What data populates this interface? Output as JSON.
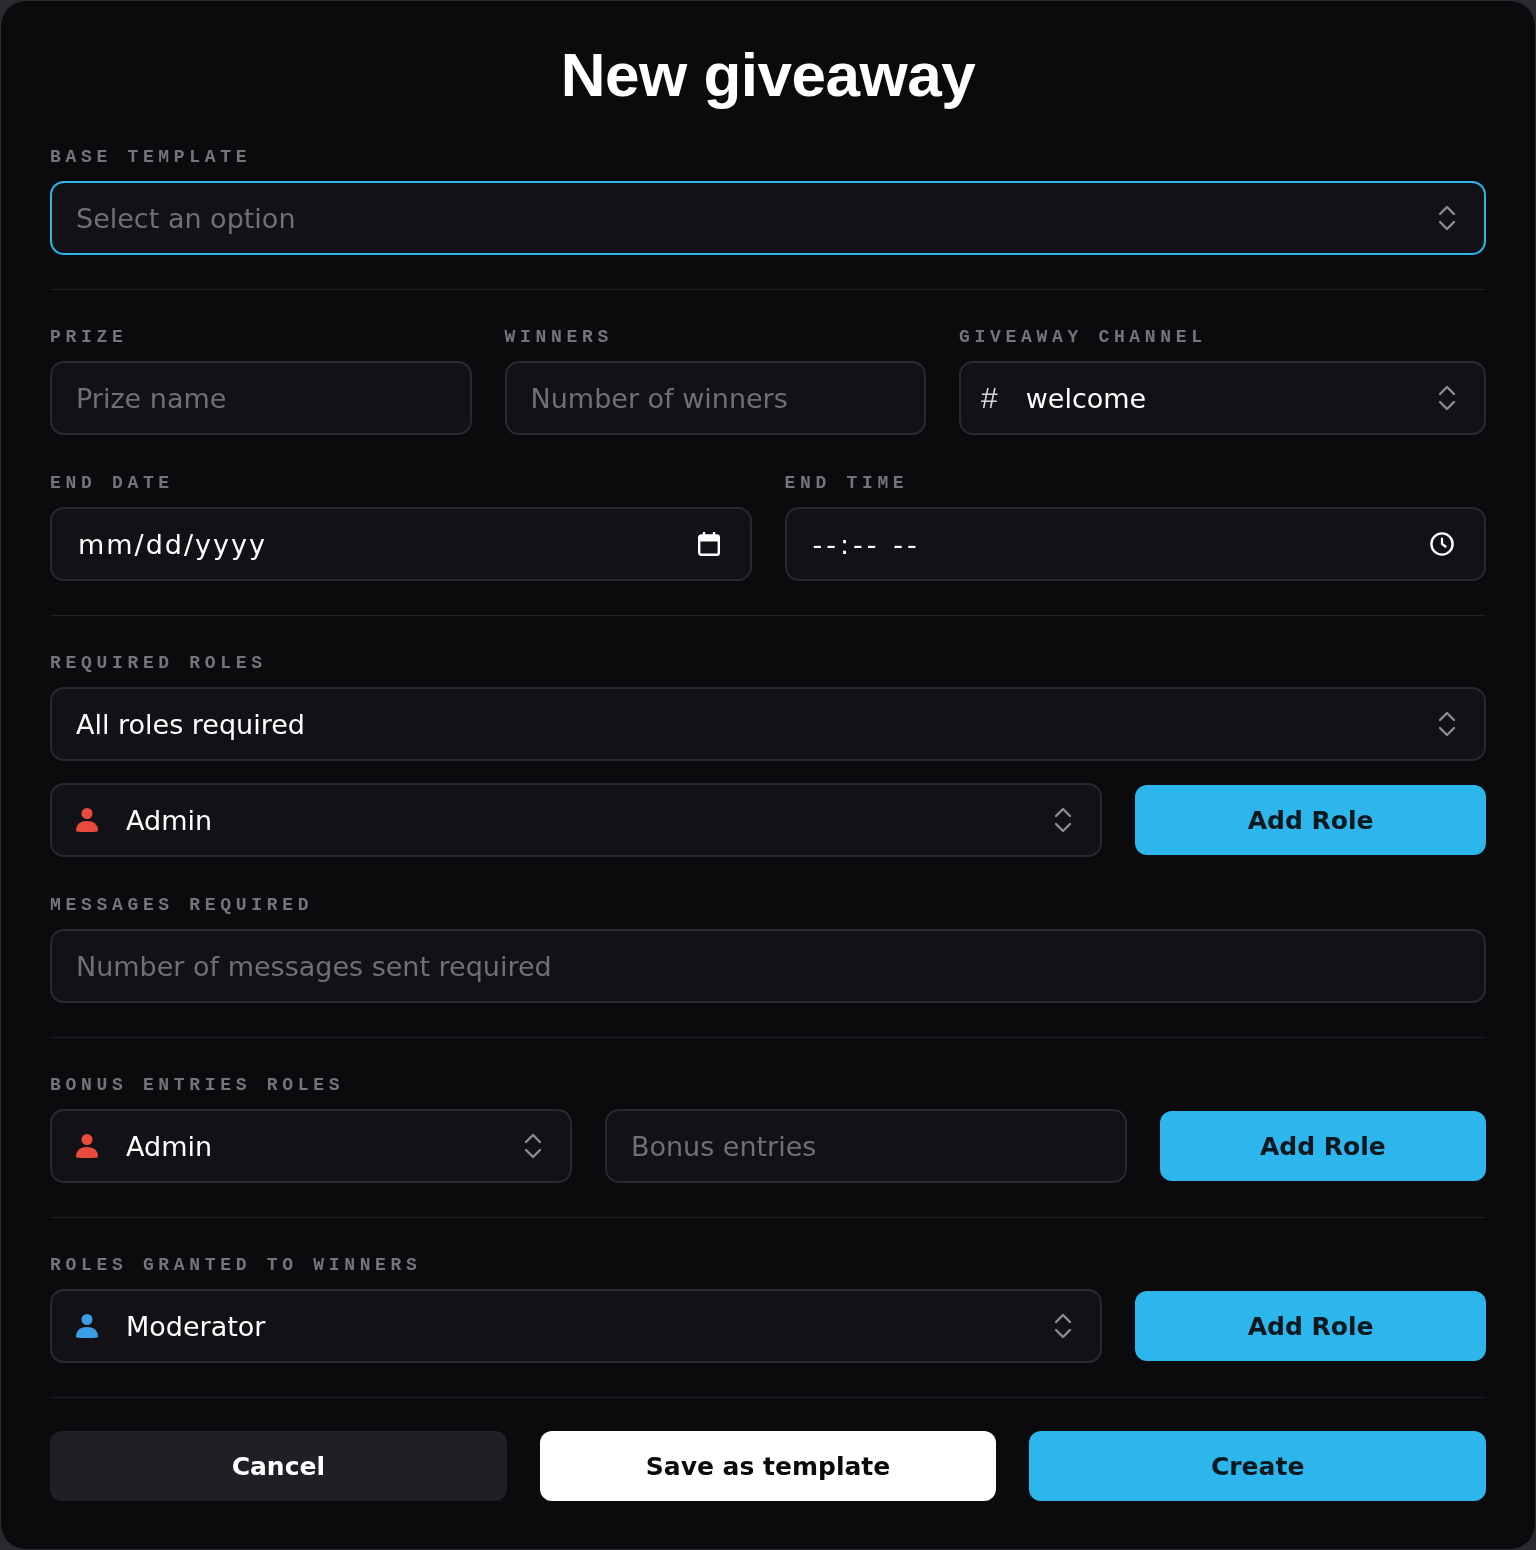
{
  "title": "New giveaway",
  "sections": [
    {
      "rows": [
        {
          "label": "BASE TEMPLATE",
          "items": [
            {
              "kind": "select",
              "placeholder": "Select an option",
              "focused": true
            }
          ]
        }
      ]
    },
    {
      "rows": [
        {
          "items": [
            {
              "kind": "text",
              "label": "PRIZE",
              "placeholder": "Prize name",
              "focused": false
            },
            {
              "kind": "text",
              "label": "WINNERS",
              "placeholder": "Number of winners",
              "focused": false
            },
            {
              "kind": "channel",
              "label": "GIVEAWAY CHANNEL",
              "prefix": "#",
              "value": "welcome",
              "focused": false
            }
          ]
        },
        {
          "items": [
            {
              "kind": "date",
              "label": "END DATE",
              "placeholder": "mm/dd/yyyy",
              "focused": false
            },
            {
              "kind": "time",
              "label": "END TIME",
              "placeholder": "--:-- --",
              "focused": false
            }
          ]
        }
      ]
    },
    {
      "rows": [
        {
          "label": "REQUIRED ROLES",
          "items": [
            {
              "kind": "select",
              "value": "All roles required",
              "focused": false
            }
          ]
        },
        {
          "items": [
            {
              "kind": "role",
              "value": "Admin",
              "color": "#e84b3c",
              "focused": false
            },
            {
              "kind": "button",
              "text": "Add Role"
            }
          ]
        },
        {
          "label": "MESSAGES REQUIRED",
          "items": [
            {
              "kind": "text",
              "placeholder": "Number of messages sent required",
              "focused": false
            }
          ]
        }
      ]
    },
    {
      "rows": [
        {
          "label": "BONUS ENTRIES ROLES",
          "items": [
            {
              "kind": "role",
              "value": "Admin",
              "color": "#e84b3c",
              "focused": false
            },
            {
              "kind": "text",
              "placeholder": "Bonus entries",
              "focused": false
            },
            {
              "kind": "button",
              "text": "Add Role"
            }
          ]
        }
      ]
    },
    {
      "rows": [
        {
          "label": "ROLES GRANTED TO WINNERS",
          "items": [
            {
              "kind": "role",
              "value": "Moderator",
              "color": "#3b9de2",
              "focused": false
            },
            {
              "kind": "button",
              "text": "Add Role"
            }
          ]
        }
      ]
    }
  ],
  "actions": [
    {
      "kind": "secondary",
      "text": "Cancel"
    },
    {
      "kind": "light",
      "text": "Save as template"
    },
    {
      "kind": "primary",
      "text": "Create"
    }
  ]
}
